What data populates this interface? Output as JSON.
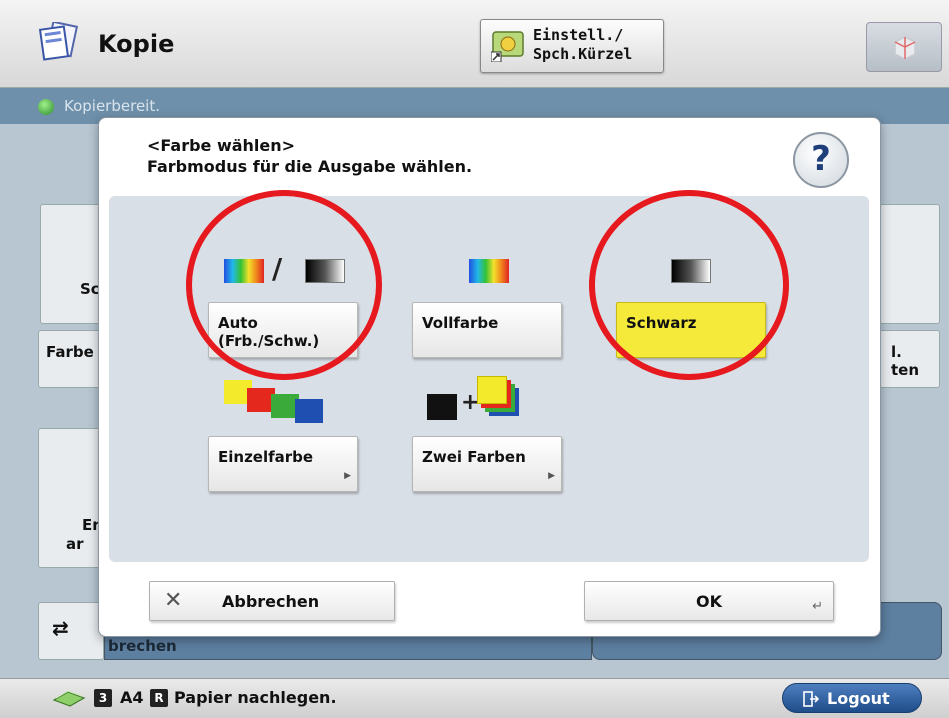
{
  "header": {
    "title": "Kopie",
    "shortcut_line1": "Einstell./",
    "shortcut_line2": "Spch.Kürzel",
    "app_icon": "copy-documents-icon",
    "shortcut_icon": "shortcut-settings-icon",
    "box_icon": "box-icon"
  },
  "status": {
    "text": "Kopierbereit.",
    "icon": "ready-status-icon"
  },
  "background": {
    "card_left_label": "Sc",
    "farbe_label": "Farbe",
    "right_label_1": "l.",
    "right_label_2": "ten",
    "er_label": "Er",
    "ar_label": "ar",
    "brechen_label": "brechen"
  },
  "dialog": {
    "title": "<Farbe wählen>",
    "subtitle": "Farbmodus für die Ausgabe wählen.",
    "help_label": "?",
    "slash": "/",
    "plus": "+",
    "options": [
      {
        "label": "Auto\n(Frb./Schw.)",
        "selected": false
      },
      {
        "label": "Vollfarbe",
        "selected": false
      },
      {
        "label": "Schwarz",
        "selected": true
      },
      {
        "label": "Einzelfarbe",
        "selected": false,
        "submenu": true
      },
      {
        "label": "Zwei Farben",
        "selected": false,
        "submenu": true
      }
    ],
    "opt_auto_line1": "Auto",
    "opt_auto_line2": "(Frb./Schw.)",
    "opt_full": "Vollfarbe",
    "opt_black": "Schwarz",
    "opt_single": "Einzelfarbe",
    "opt_two": "Zwei Farben",
    "cancel_label": "Abbrechen",
    "ok_label": "OK"
  },
  "footer": {
    "badge1": "3",
    "paper_size": "A4",
    "badge2": "R",
    "message": "Papier nachlegen.",
    "logout_label": "Logout"
  },
  "colors": {
    "selected_option": "#f5ea3a",
    "highlight_circle": "#e5191e",
    "status_bar": "#6f90aa"
  }
}
